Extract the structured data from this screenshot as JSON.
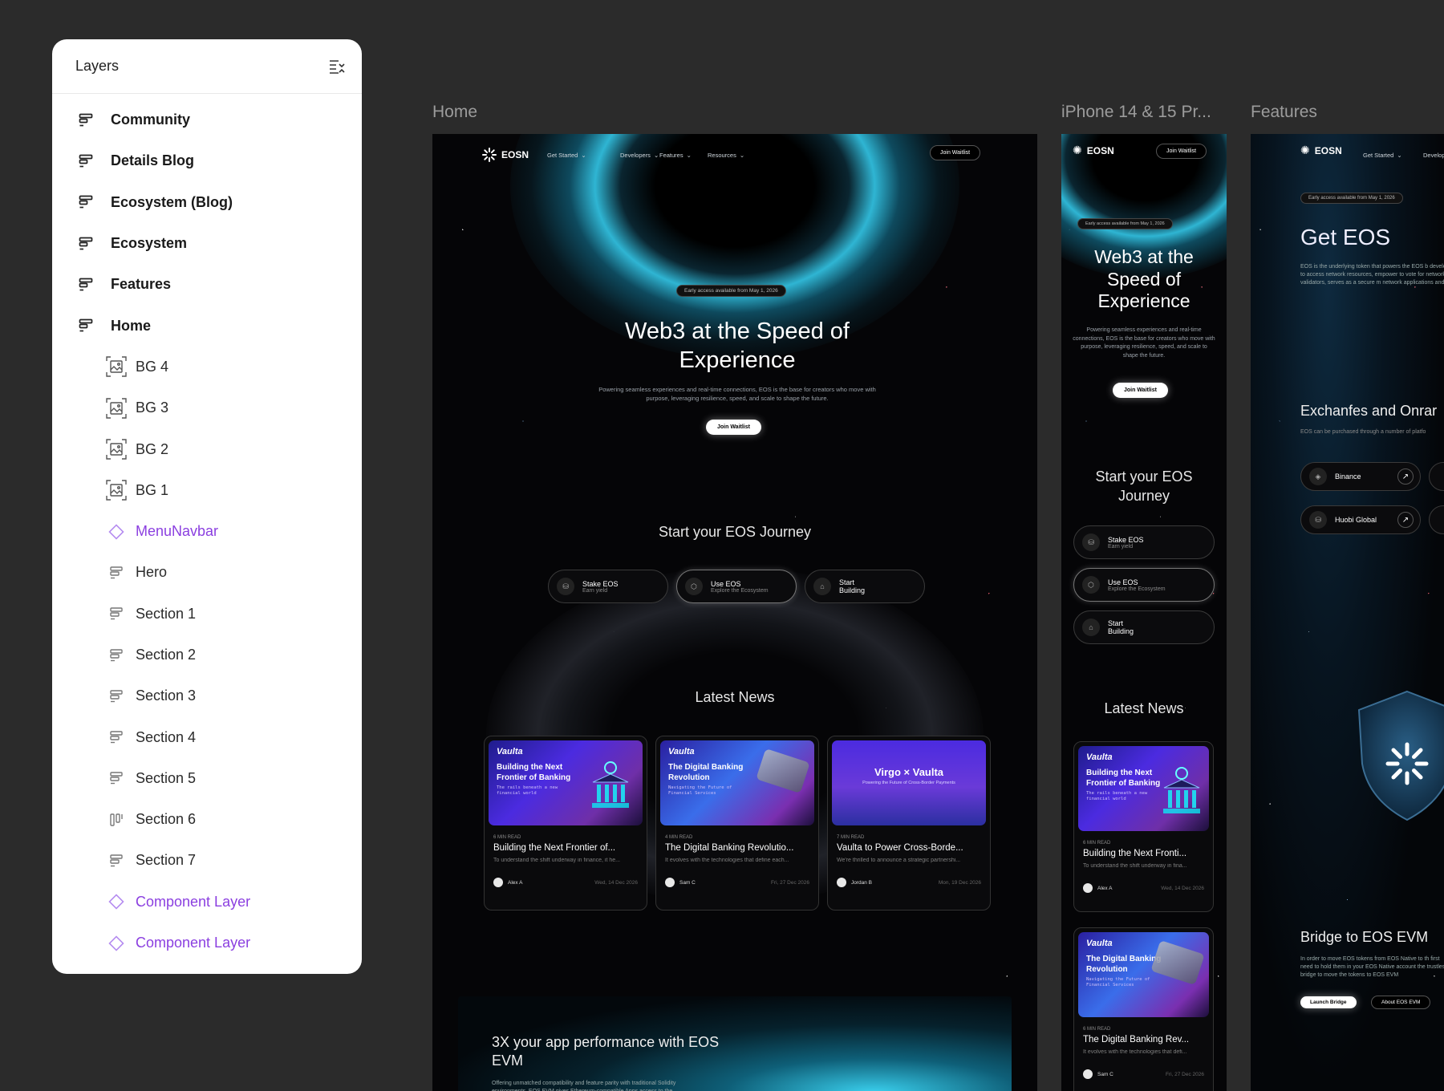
{
  "layers": {
    "title": "Layers",
    "items": [
      {
        "label": "Community",
        "level": "top",
        "icon": "frame-icon"
      },
      {
        "label": "Details Blog",
        "level": "top",
        "icon": "frame-icon"
      },
      {
        "label": "Ecosystem (Blog)",
        "level": "top",
        "icon": "frame-icon"
      },
      {
        "label": "Ecosystem",
        "level": "top",
        "icon": "frame-icon"
      },
      {
        "label": "Features",
        "level": "top",
        "icon": "frame-icon"
      },
      {
        "label": "Home",
        "level": "top",
        "icon": "frame-icon"
      },
      {
        "label": "BG 4",
        "level": "child",
        "icon": "image-icon"
      },
      {
        "label": "BG 3",
        "level": "child",
        "icon": "image-icon"
      },
      {
        "label": "BG 2",
        "level": "child",
        "icon": "image-icon"
      },
      {
        "label": "BG 1",
        "level": "child",
        "icon": "image-icon"
      },
      {
        "label": "MenuNavbar",
        "level": "child",
        "icon": "component-icon"
      },
      {
        "label": "Hero",
        "level": "child",
        "icon": "stack-icon"
      },
      {
        "label": "Section 1",
        "level": "child",
        "icon": "stack-icon"
      },
      {
        "label": "Section 2",
        "level": "child",
        "icon": "stack-icon"
      },
      {
        "label": "Section 3",
        "level": "child",
        "icon": "stack-icon"
      },
      {
        "label": "Section 4",
        "level": "child",
        "icon": "stack-icon"
      },
      {
        "label": "Section 5",
        "level": "child",
        "icon": "stack-icon"
      },
      {
        "label": "Section 6",
        "level": "child",
        "icon": "columns-icon"
      },
      {
        "label": "Section 7",
        "level": "child",
        "icon": "stack-icon"
      },
      {
        "label": "Component Layer",
        "level": "child",
        "icon": "component-icon"
      },
      {
        "label": "Component Layer",
        "level": "child",
        "icon": "component-icon"
      }
    ]
  },
  "frames": {
    "home_label": "Home",
    "iphone_label": "iPhone 14 & 15 Pr...",
    "features_label": "Features"
  },
  "site": {
    "logo": "EOSN",
    "nav": [
      "Get Started",
      "Developers",
      "Features",
      "Resources"
    ],
    "nav_button": "Join Waitlist",
    "badge": "Early access available from May 1, 2026",
    "hero_title": "Web3 at the Speed of Experience",
    "hero_sub": "Powering seamless experiences and real-time connections, EOS is the base for creators who move with purpose, leveraging resilience, speed, and scale to shape the future.",
    "hero_button": "Join Waitlist",
    "journey_title": "Start your EOS Journey",
    "journey": [
      {
        "title": "Stake EOS",
        "sub": "Earn yield"
      },
      {
        "title": "Use EOS",
        "sub": "Explore the Ecosystem"
      },
      {
        "title": "Start Building",
        "sub": ""
      }
    ],
    "news_title": "Latest News",
    "news": [
      {
        "brand": "Vaulta",
        "img_title": "Building the Next Frontier of Banking",
        "img_sub": "The rails beneath a new financial world",
        "read": "6 MIN READ",
        "title": "Building the Next Frontier of...",
        "desc": "To understand the shift underway in finance, it he...",
        "author": "Alex A",
        "date": "Wed, 14 Dec 2026"
      },
      {
        "brand": "Vaulta",
        "img_title": "The Digital Banking Revolution",
        "img_sub": "Navigating the Future of Financial Services",
        "read": "4 MIN READ",
        "title": "The Digital Banking Revolutio...",
        "desc": "It evolves with the technologies that define each...",
        "author": "Sam C",
        "date": "Fri, 27 Dec 2026"
      },
      {
        "brand": "Virgo × Vaulta",
        "img_title": "",
        "img_sub": "Powering the Future of Cross-Border Payments",
        "read": "7 MIN READ",
        "title": "Vaulta to Power Cross-Borde...",
        "desc": "We're thrilled to announce a strategic partnershi...",
        "author": "Jordan B",
        "date": "Mon, 19 Dec 2026"
      }
    ],
    "evm_title": "3X your app performance with EOS EVM",
    "evm_desc": "Offering unmatched compatibility and feature parity with traditional Solidity environments. EOS EVM gives Ethereum-compatible Apps access to the"
  },
  "iphone": {
    "hero_title": "Web3 at the Speed of Experience",
    "journey_title": "Start your EOS Journey",
    "news_title": "Latest News",
    "news": [
      {
        "title": "Building the Next Fronti...",
        "desc": "To understand the shift underway in fina...",
        "author": "Alex A",
        "date": "Wed, 14 Dec 2026",
        "read": "6 MIN READ"
      },
      {
        "title": "The Digital Banking Rev...",
        "desc": "It evolves with the technologies that defi...",
        "author": "Sam C",
        "date": "Fri, 27 Dec 2026",
        "read": "6 MIN READ"
      }
    ]
  },
  "features": {
    "badge": "Early access available from May 1, 2026",
    "title": "Get EOS",
    "desc": "EOS is the underlying token that powers the EOS b developers to access network resources, empower to vote for network validators, serves as a secure m network applications and more.",
    "exchanges_title": "Exchanfes and Onrar",
    "exchanges_desc": "EOS can be purchased through a number of platfo",
    "exchanges": [
      "Binance",
      "Huobi Global"
    ],
    "bridge_title": "Bridge to EOS EVM",
    "bridge_desc": "In order to move EOS tokens from EOS Native to th first need to hold them in your EOS Native account the trustless bridge to move the tokens to EOS EVM",
    "bridge_buttons": [
      "Launch Bridge",
      "About EOS EVM"
    ]
  },
  "colors": {
    "accent_purple": "#8b3fe0",
    "canvas": "#2b2b2b",
    "cyan_glow": "#2fb5d3"
  }
}
